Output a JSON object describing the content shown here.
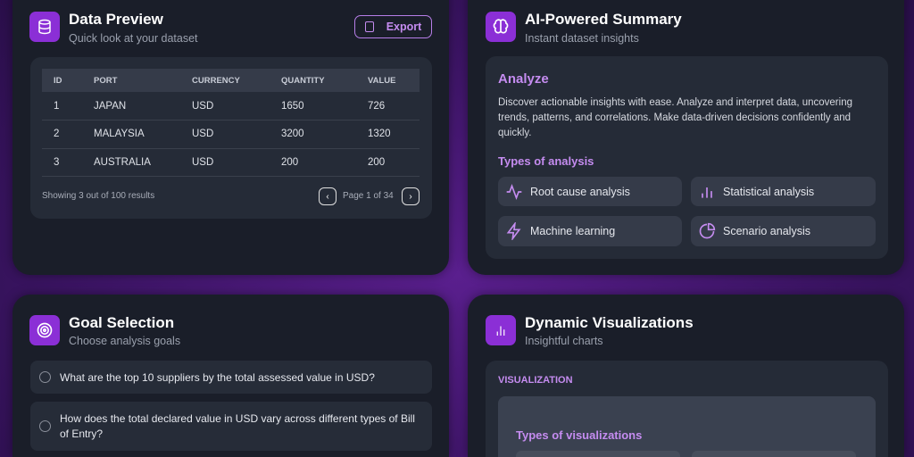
{
  "data_preview": {
    "title": "Data Preview",
    "subtitle": "Quick look at your dataset",
    "export_label": "Export",
    "columns": [
      "ID",
      "PORT",
      "CURRENCY",
      "QUANTITY",
      "VALUE"
    ],
    "rows": [
      [
        "1",
        "JAPAN",
        "USD",
        "1650",
        "726"
      ],
      [
        "2",
        "MALAYSIA",
        "USD",
        "3200",
        "1320"
      ],
      [
        "3",
        "AUSTRALIA",
        "USD",
        "200",
        "200"
      ]
    ],
    "showing": "Showing 3 out of 100 results",
    "page": "Page 1 of 34",
    "prev": "‹",
    "next": "›"
  },
  "summary": {
    "title": "AI-Powered Summary",
    "subtitle": "Instant dataset insights",
    "heading": "Analyze",
    "description": "Discover actionable insights with ease. Analyze and interpret data, uncovering trends, patterns, and correlations. Make data-driven decisions confidently and quickly.",
    "types_heading": "Types of analysis",
    "types": [
      "Root cause analysis",
      "Statistical analysis",
      "Machine learning",
      "Scenario analysis"
    ]
  },
  "goals": {
    "title": "Goal Selection",
    "subtitle": "Choose analysis goals",
    "options": [
      "What are the top 10 suppliers by the total assessed value in USD?",
      "How does the total declared value in USD vary across different types of Bill of Entry?"
    ]
  },
  "viz": {
    "title": "Dynamic Visualizations",
    "subtitle": "Insightful charts",
    "section_label": "VISUALIZATION",
    "types_heading": "Types of visualizations"
  },
  "colors": {
    "accent": "#8b2fd6",
    "accent_text": "#c58cf0"
  }
}
